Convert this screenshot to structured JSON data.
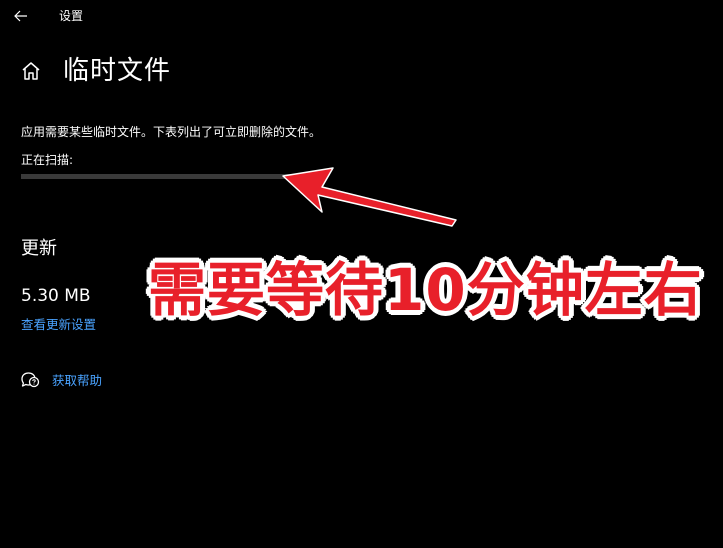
{
  "window": {
    "app_title": "设置"
  },
  "header": {
    "title": "临时文件"
  },
  "main": {
    "description": "应用需要某些临时文件。下表列出了可立即删除的文件。",
    "scan_label": "正在扫描:",
    "scan_progress_percent": 100,
    "updates": {
      "title": "更新",
      "size": "5.30 MB",
      "link": "查看更新设置"
    },
    "help": {
      "link": "获取帮助"
    }
  },
  "annotation": {
    "text": "需要等待10分钟左右",
    "color": "#e8202a",
    "outline_color": "#ffffff"
  },
  "colors": {
    "background": "#000000",
    "link": "#4aa3ff",
    "progress_track": "#333333"
  },
  "icons": {
    "back": "back-arrow-icon",
    "home": "home-icon",
    "help": "chat-help-icon"
  }
}
